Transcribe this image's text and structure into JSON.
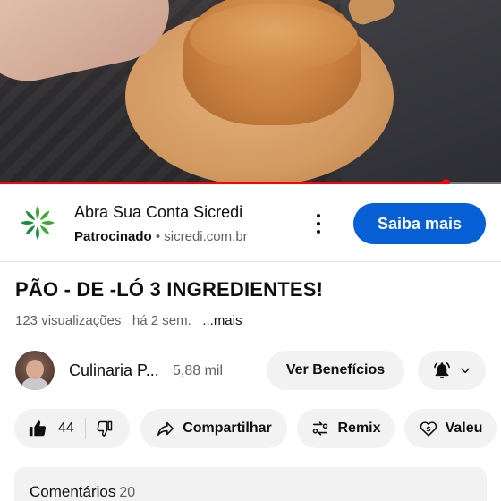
{
  "video": {
    "progress_fraction": 0.89,
    "accent_color": "#ff0000"
  },
  "ad": {
    "title": "Abra Sua Conta Sicredi",
    "sponsored_label": "Patrocinado",
    "separator": "•",
    "domain": "sicredi.com.br",
    "cta_label": "Saiba mais",
    "cta_color": "#065fd4",
    "logo_icon": "sicredi-logo",
    "menu_icon": "more-vert-icon"
  },
  "video_info": {
    "title": "PÃO - DE -LÓ 3 INGREDIENTES!",
    "views": "123 visualizações",
    "age": "há 2 sem.",
    "more_label": "...mais"
  },
  "channel": {
    "name": "Culinaria P...",
    "subscribers": "5,88 mil",
    "benefits_label": "Ver Benefícios",
    "bell_icon": "bell-icon",
    "chevron_icon": "chevron-down-icon"
  },
  "actions": {
    "like_count": "44",
    "like_icon": "thumbs-up-icon",
    "dislike_icon": "thumbs-down-icon",
    "share_label": "Compartilhar",
    "share_icon": "share-icon",
    "remix_label": "Remix",
    "remix_icon": "remix-icon",
    "thanks_label": "Valeu",
    "thanks_icon": "super-thanks-icon"
  },
  "comments": {
    "label": "Comentários",
    "count": "20"
  }
}
